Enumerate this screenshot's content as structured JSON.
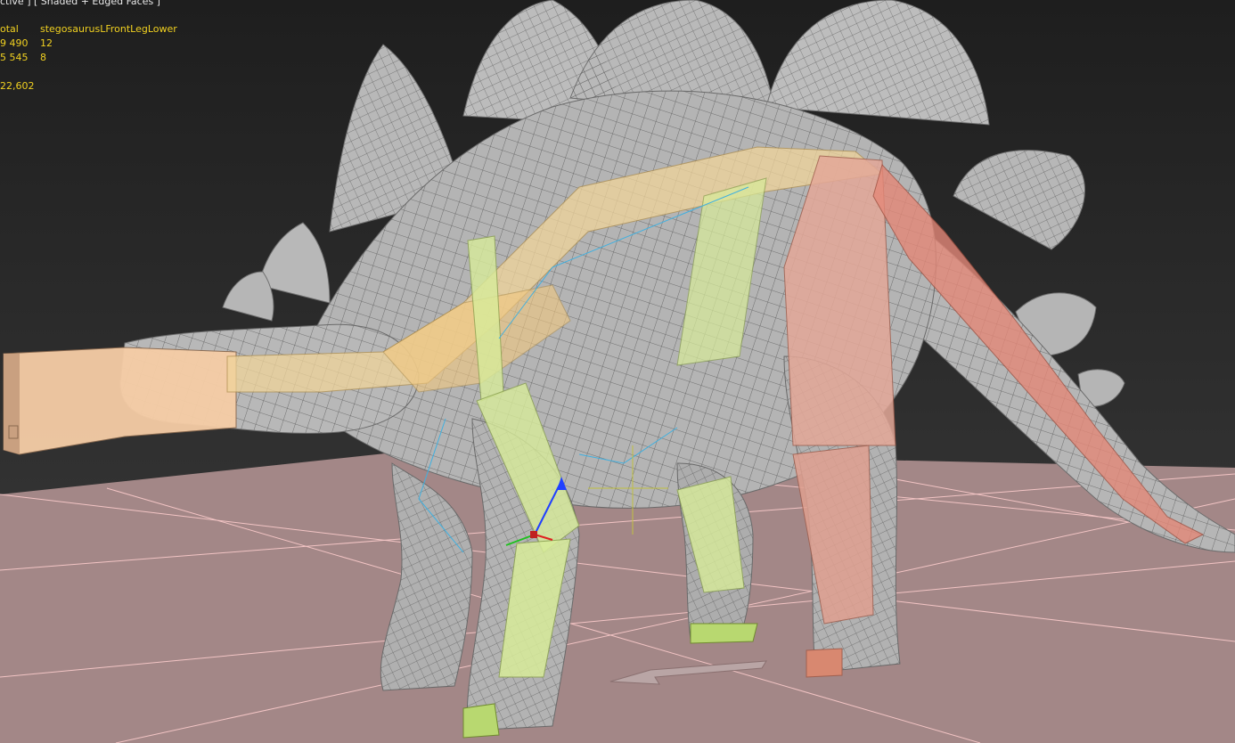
{
  "viewport": {
    "label": "ctive ] [ Shaded + Edged Faces ]",
    "colors": {
      "background_top": "#1e1e1e",
      "background_bottom": "#3a3a3a",
      "grid_floor": "#a38787",
      "grid_lines": "#f2c4c4",
      "mesh": "#b4b4b4",
      "mesh_wire": "#5a5a5a",
      "bone_head": "#f6cda6",
      "bone_spine": "#f0d49a",
      "bone_left": "#d8ec9a",
      "bone_right": "#e4a898",
      "stats_text": "#f0d020"
    }
  },
  "stats": {
    "header": {
      "total": "otal",
      "selected": "stegosaurusLFrontLegLower"
    },
    "rows": [
      {
        "total": "9 490",
        "selected": "12"
      },
      {
        "total": "5 545",
        "selected": "8"
      }
    ],
    "fps": "22,602"
  },
  "gizmo": {
    "icon": "transform-gizmo-icon"
  }
}
